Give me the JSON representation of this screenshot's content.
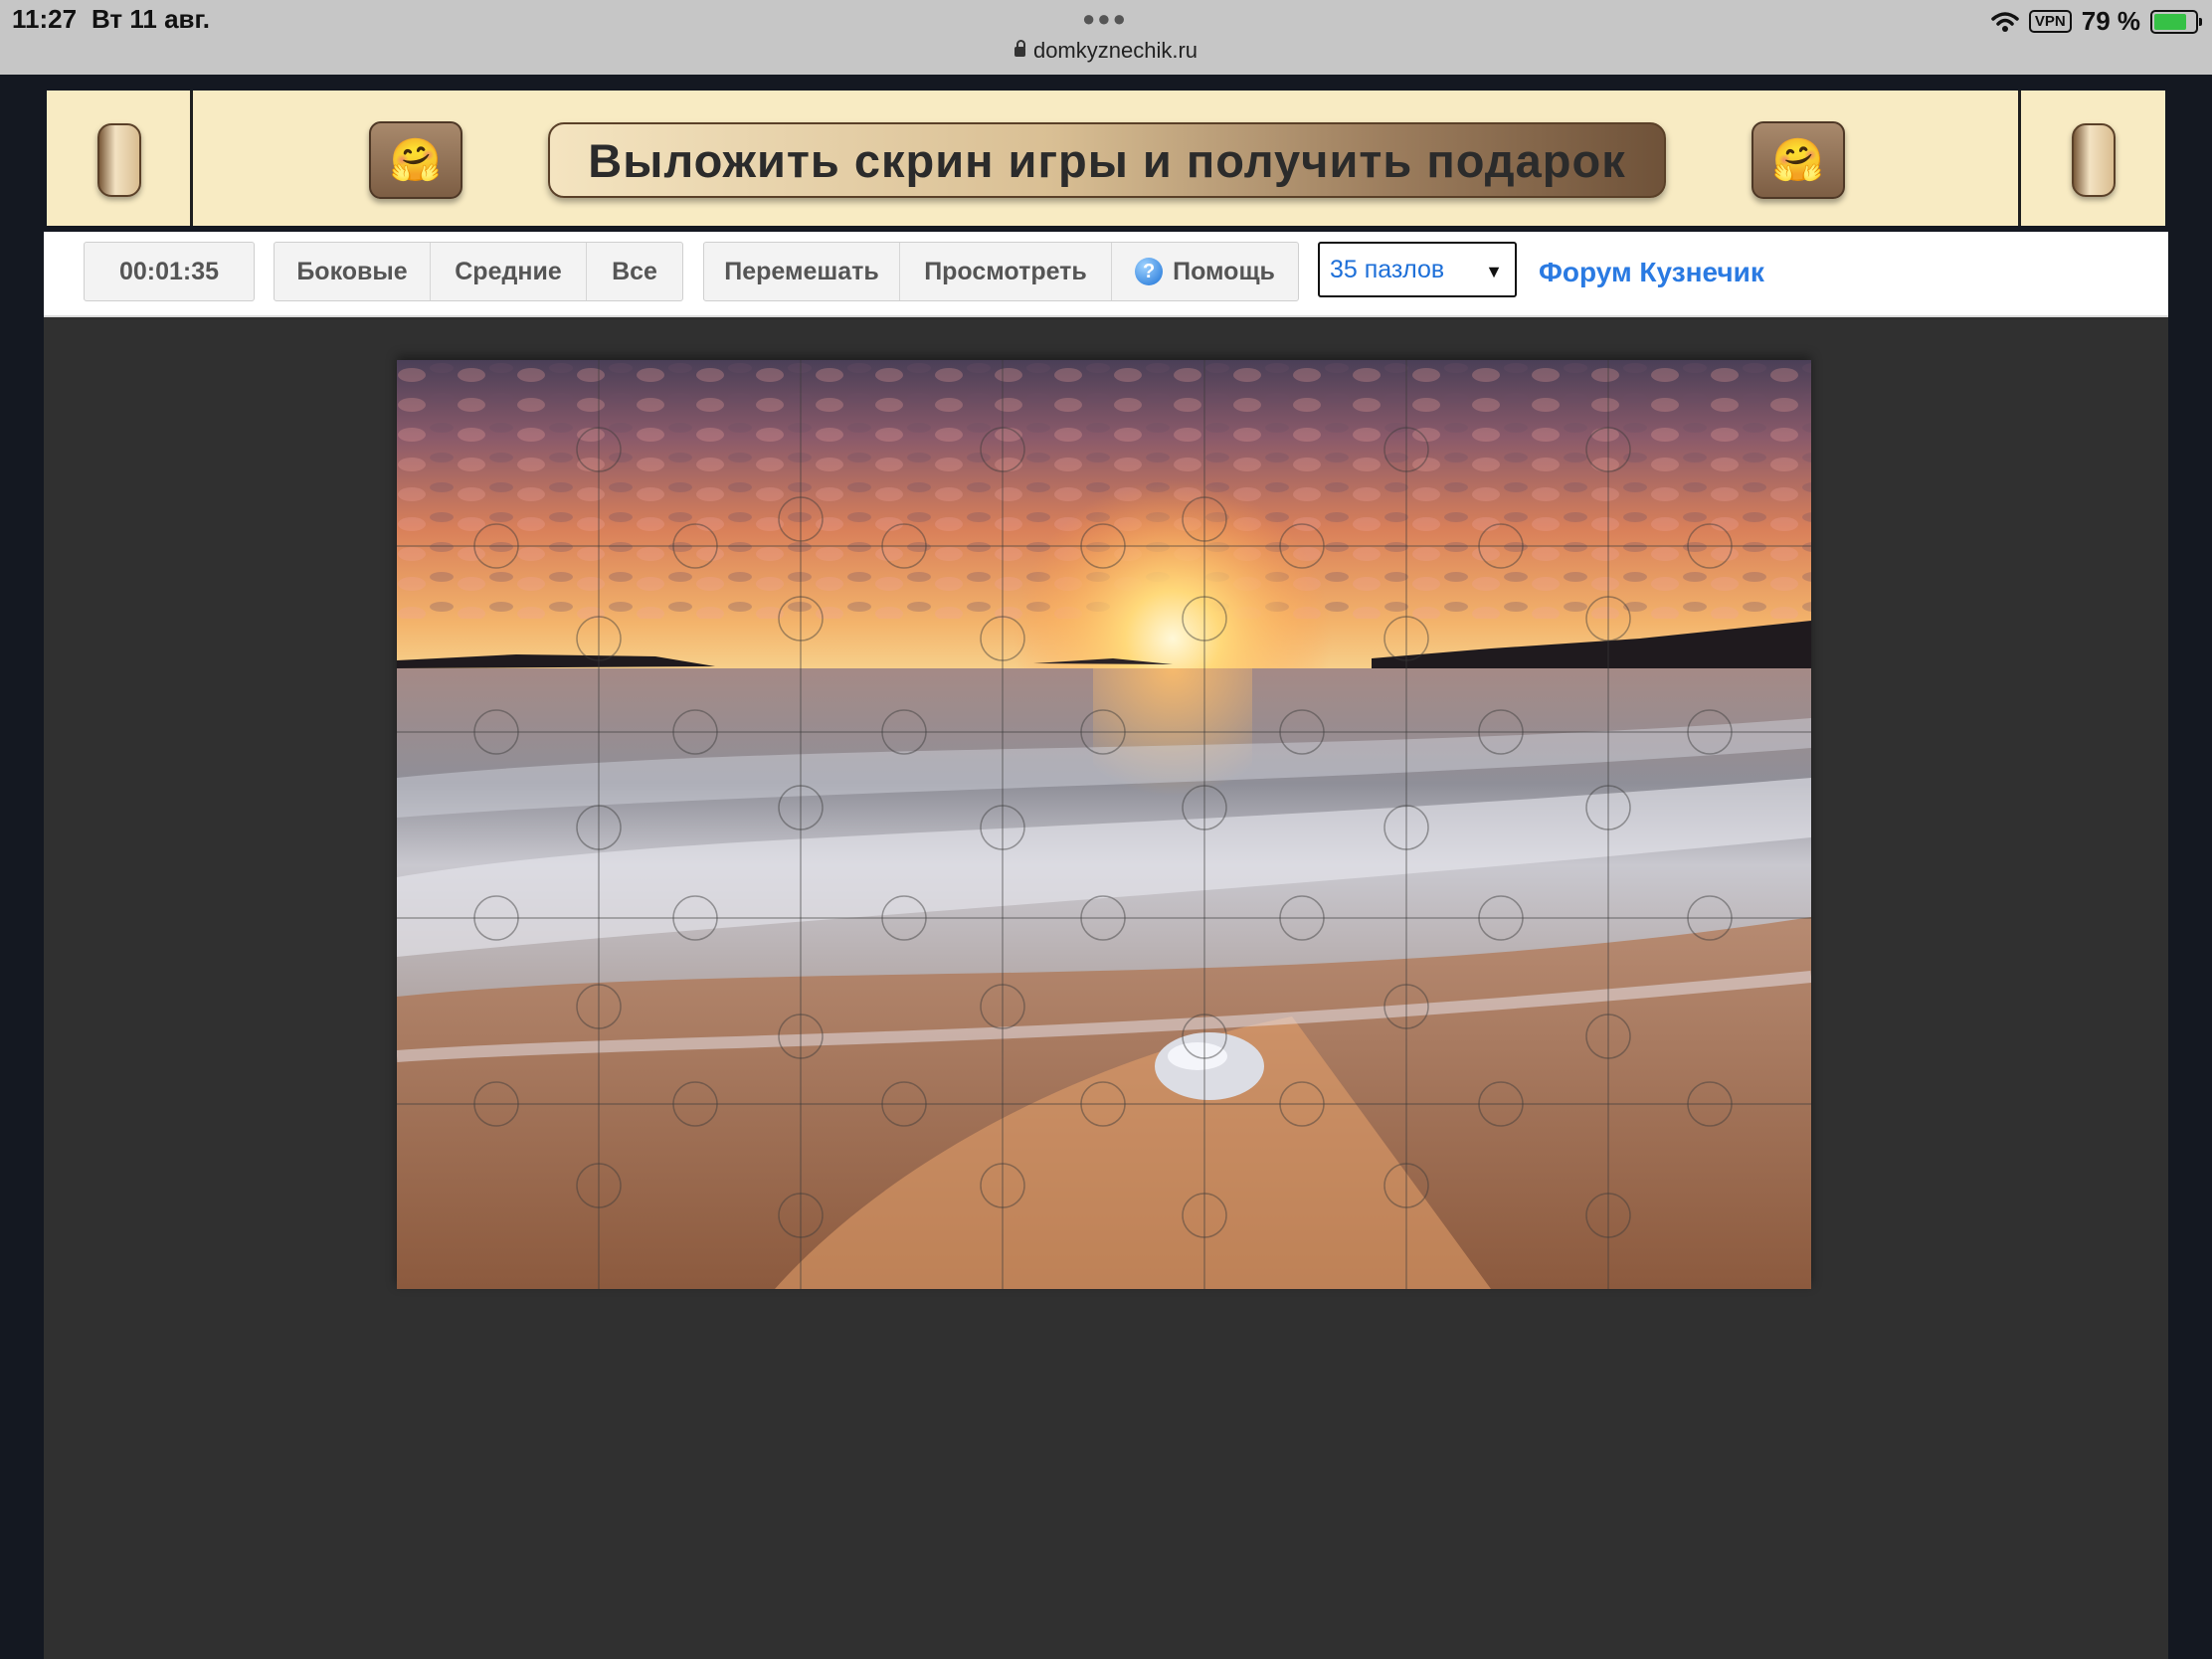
{
  "status_bar": {
    "time": "11:27",
    "date": "Вт 11 авг.",
    "url": "domkyznechik.ru",
    "vpn": "VPN",
    "battery": "79 %",
    "battery_level": 0.79
  },
  "banner": {
    "cta": "Выложить скрин игры и получить подарок",
    "emoji": "🤗"
  },
  "toolbar": {
    "timer": "00:01:35",
    "filter_buttons": [
      "Боковые",
      "Средние",
      "Все"
    ],
    "shuffle": "Перемешать",
    "preview": "Просмотреть",
    "help": "Помощь",
    "help_icon": "question-icon",
    "pieces_select": "35 пазлов",
    "forum_link": "Форум Кузнечик"
  },
  "puzzle": {
    "columns": 7,
    "rows": 5,
    "pieces": 35,
    "image": "sunset over sea beach with rock"
  },
  "colors": {
    "accent_link": "#2a7ae2",
    "banner_bg": "#f8ebc3",
    "play_bg": "#303030"
  }
}
